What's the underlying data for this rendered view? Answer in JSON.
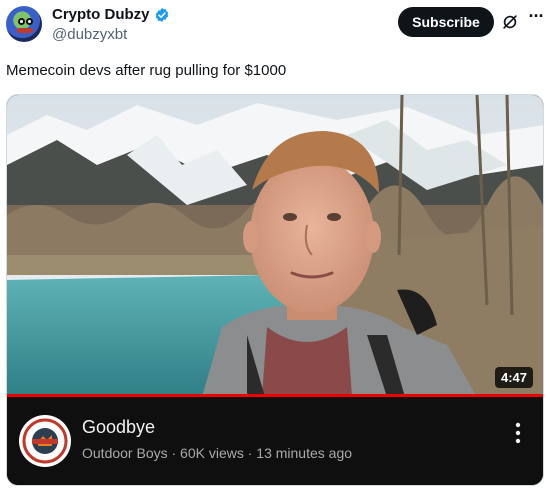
{
  "post": {
    "display_name": "Crypto Dubzy",
    "handle": "@dubzyxbt",
    "subscribe_label": "Subscribe",
    "text": "Memecoin devs after rug pulling for $1000",
    "icons": [
      "verified-badge-icon",
      "grok-icon",
      "more-icon"
    ]
  },
  "video": {
    "duration": "4:47",
    "title": "Goodbye",
    "meta": "Outdoor Boys · 60K views · 13 minutes ago",
    "channel_logo_text": "OUTDOOR BOYS",
    "accent_color": "#ff0000"
  },
  "colors": {
    "verified": "#1d9bf0",
    "subscribe_bg": "#0f1419",
    "video_panel_bg": "#0f0f0f"
  }
}
